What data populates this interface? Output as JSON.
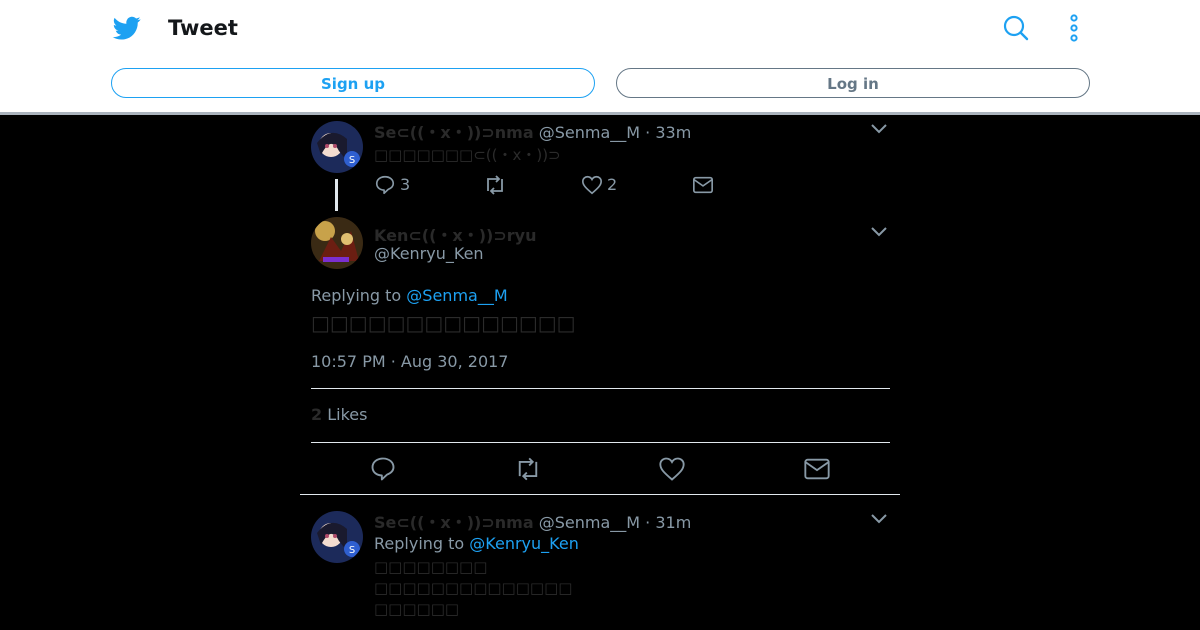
{
  "header": {
    "title": "Tweet",
    "signup_label": "Sign up",
    "login_label": "Log in"
  },
  "tweet1": {
    "name": "Se⊂((・x・))⊃nma",
    "handle": "@Senma__M",
    "time": "· 33m",
    "text": "□□□□□□□⊂((・x・))⊃",
    "reply_count": "3",
    "like_count": "2"
  },
  "main_tweet": {
    "name": "Ken⊂((・x・))⊃ryu",
    "handle": "@Kenryu_Ken",
    "replying_prefix": "Replying to",
    "replying_to": "@Senma__M",
    "text": "□□□□□□□□□□□□□□",
    "timestamp": "10:57 PM · Aug 30, 2017",
    "likes_count": "2",
    "likes_label": "Likes"
  },
  "tweet3": {
    "name": "Se⊂((・x・))⊃nma",
    "handle": "@Senma__M",
    "time": "· 31m",
    "replying_prefix": "Replying to",
    "replying_to": "@Kenryu_Ken",
    "lines": [
      "□□□□□□□□",
      "□□□□□□□□□□□□□□",
      "□□□□□□"
    ]
  },
  "colors": {
    "accent": "#1da1f2",
    "muted": "#8899a6",
    "background": "#000000"
  }
}
